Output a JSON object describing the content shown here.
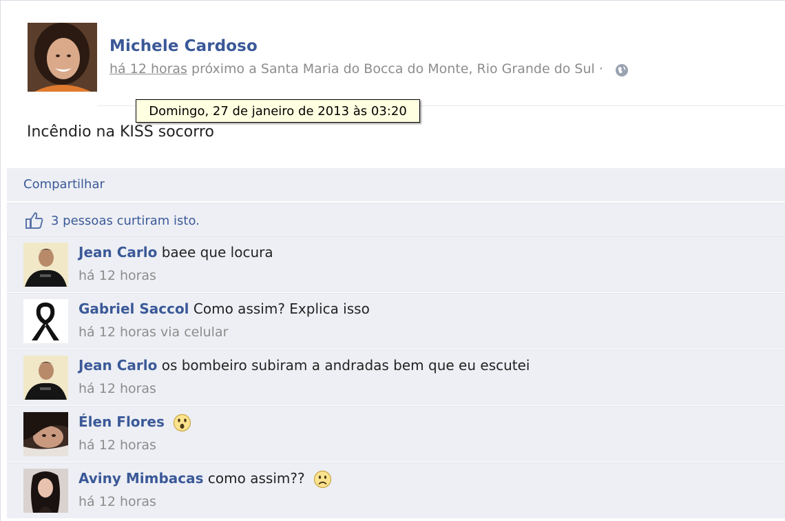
{
  "post": {
    "author": "Michele Cardoso",
    "time": "há 12 horas",
    "location": "próximo a Santa Maria do Bocca do Monte, Rio Grande do Sul ·",
    "tooltip": "Domingo, 27 de janeiro de 2013 às 03:20",
    "text": "Incêndio na KISS socorro",
    "privacy_icon": "globe-icon"
  },
  "actions": {
    "share_label": "Compartilhar"
  },
  "likes": {
    "text": "3 pessoas curtiram isto.",
    "icon": "thumbs-up-icon"
  },
  "comments": [
    {
      "name": "Jean Carlo",
      "text": "baee que locura",
      "time": "há 12 horas",
      "emoji": ""
    },
    {
      "name": "Gabriel Saccol",
      "text": "Como assim? Explica isso",
      "time": "há 12 horas via celular",
      "emoji": ""
    },
    {
      "name": "Jean Carlo",
      "text": "os bombeiro subiram a andradas bem que eu escutei",
      "time": "há 12 horas",
      "emoji": ""
    },
    {
      "name": "Élen Flores",
      "text": "",
      "time": "há 12 horas",
      "emoji": "gasp-emoji-icon"
    },
    {
      "name": "Aviny Mimbacas",
      "text": "como assim??",
      "time": "há 12 horas",
      "emoji": "frown-emoji-icon"
    }
  ]
}
